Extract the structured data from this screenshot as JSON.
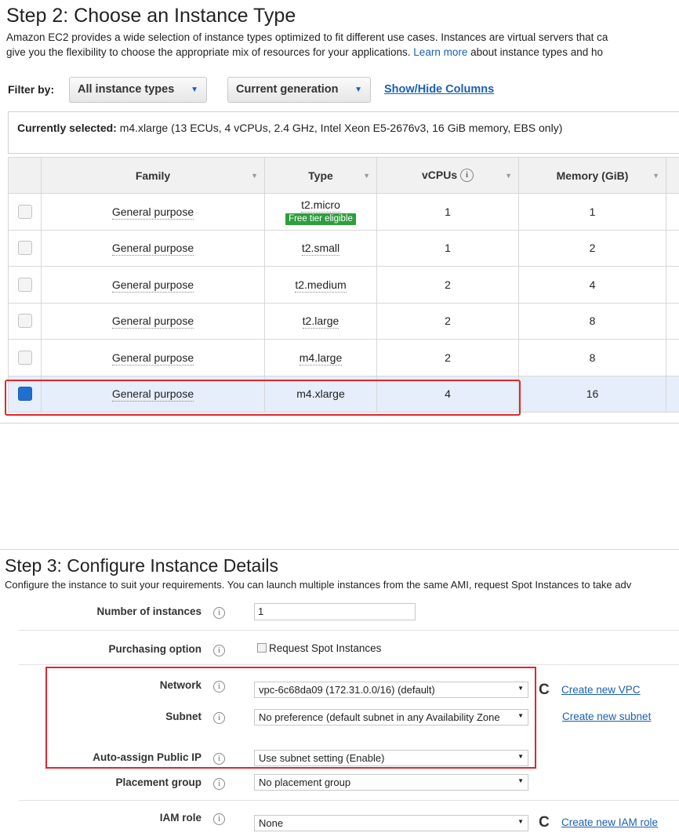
{
  "step2": {
    "title": "Step 2: Choose an Instance Type",
    "desc_line1": "Amazon EC2 provides a wide selection of instance types optimized to fit different use cases. Instances are virtual servers that ca",
    "desc_line2_pre": "give you the flexibility to choose the appropriate mix of resources for your applications.",
    "learn_more": "Learn more",
    "desc_line2_post": "about instance types and ho",
    "filter_label": "Filter by:",
    "filter_type": "All instance types",
    "filter_generation": "Current generation",
    "show_hide": "Show/Hide Columns",
    "currently_selected_label": "Currently selected:",
    "currently_selected_value": "m4.xlarge (13 ECUs, 4 vCPUs, 2.4 GHz, Intel Xeon E5-2676v3, 16 GiB memory, EBS only)",
    "columns": [
      "Family",
      "Type",
      "vCPUs",
      "Memory (GiB)"
    ],
    "rows": [
      {
        "family": "General purpose",
        "type": "t2.micro",
        "badge": "Free tier eligible",
        "vcpus": "1",
        "memory": "1"
      },
      {
        "family": "General purpose",
        "type": "t2.small",
        "vcpus": "1",
        "memory": "2"
      },
      {
        "family": "General purpose",
        "type": "t2.medium",
        "vcpus": "2",
        "memory": "4"
      },
      {
        "family": "General purpose",
        "type": "t2.large",
        "vcpus": "2",
        "memory": "8"
      },
      {
        "family": "General purpose",
        "type": "m4.large",
        "vcpus": "2",
        "memory": "8"
      },
      {
        "family": "General purpose",
        "type": "m4.xlarge",
        "vcpus": "4",
        "memory": "16",
        "selected": true
      }
    ]
  },
  "step3": {
    "title": "Step 3: Configure Instance Details",
    "desc": "Configure the instance to suit your requirements. You can launch multiple instances from the same AMI, request Spot Instances to take adv",
    "num_instances_label": "Number of instances",
    "num_instances_value": "1",
    "purchasing_label": "Purchasing option",
    "spot_label": "Request Spot Instances",
    "network_label": "Network",
    "network_value": "vpc-6c68da09 (172.31.0.0/16) (default)",
    "create_vpc": "Create new VPC",
    "subnet_label": "Subnet",
    "subnet_value": "No preference (default subnet in any Availability Zone",
    "create_subnet": "Create new subnet",
    "public_ip_label": "Auto-assign Public IP",
    "public_ip_value": "Use subnet setting (Enable)",
    "placement_label": "Placement group",
    "placement_value": "No placement group",
    "iam_label": "IAM role",
    "iam_value": "None",
    "create_iam": "Create new IAM role"
  },
  "icons": {
    "info": "i",
    "refresh": "C",
    "chevron_down": "▼",
    "sort": "▼"
  },
  "colors": {
    "link": "#1a5fb4",
    "highlight_box": "#e0262b",
    "selected_row": "#e6eefb",
    "badge_bg": "#2e9e3e"
  }
}
